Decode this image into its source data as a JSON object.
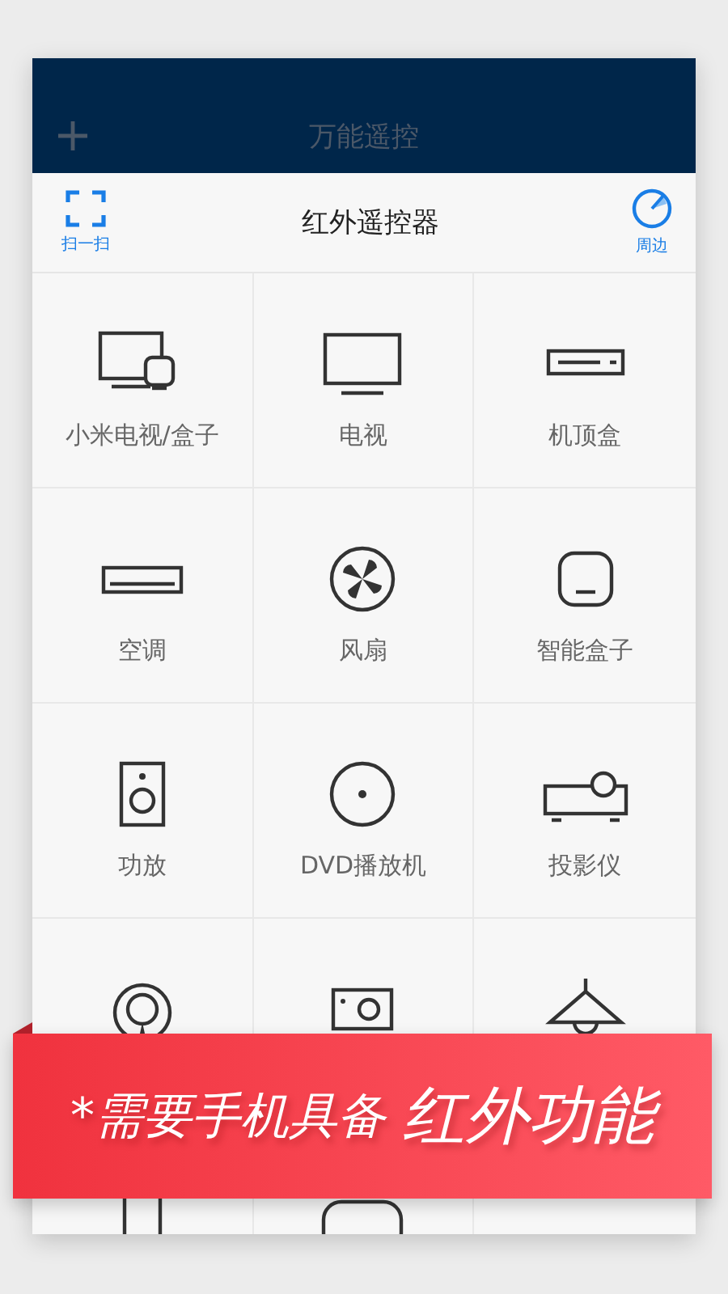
{
  "header": {
    "title": "万能遥控"
  },
  "toolbar": {
    "title": "红外遥控器",
    "left_action": {
      "label": "扫一扫"
    },
    "right_action": {
      "label": "周边"
    }
  },
  "devices": [
    {
      "kind": "tv-box",
      "label": "小米电视/盒子"
    },
    {
      "kind": "tv",
      "label": "电视"
    },
    {
      "kind": "set-top-box",
      "label": "机顶盒"
    },
    {
      "kind": "ac",
      "label": "空调"
    },
    {
      "kind": "fan",
      "label": "风扇"
    },
    {
      "kind": "smart-box",
      "label": "智能盒子"
    },
    {
      "kind": "speaker",
      "label": "功放"
    },
    {
      "kind": "dvd",
      "label": "DVD播放机"
    },
    {
      "kind": "projector",
      "label": "投影仪"
    },
    {
      "kind": "webcam"
    },
    {
      "kind": "camera"
    },
    {
      "kind": "lamp"
    },
    {
      "kind": "column"
    },
    {
      "kind": "pill"
    }
  ],
  "banner": {
    "note": "*需要手机具备",
    "highlight": "红外功能"
  }
}
